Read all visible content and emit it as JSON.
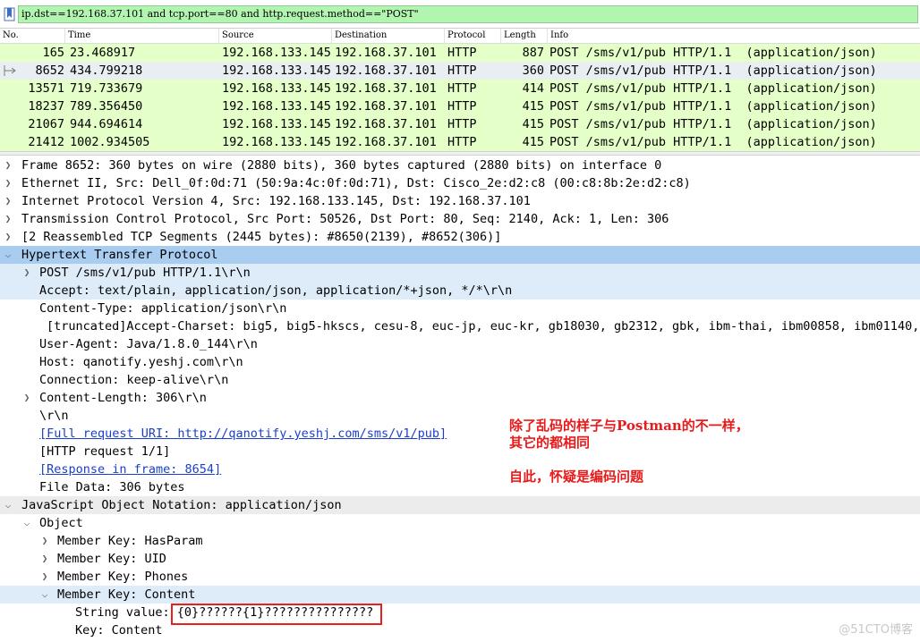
{
  "filter": {
    "value": "ip.dst==192.168.37.101 and tcp.port==80 and http.request.method==\"POST\""
  },
  "packet_list": {
    "columns": [
      "No.",
      "Time",
      "Source",
      "Destination",
      "Protocol",
      "Length",
      "Info"
    ],
    "rows": [
      {
        "no": "165",
        "time": "23.468917",
        "source": "192.168.133.145",
        "destination": "192.168.37.101",
        "protocol": "HTTP",
        "length": "887",
        "info": "POST /sms/v1/pub HTTP/1.1  (application/json)"
      },
      {
        "no": "8652",
        "time": "434.799218",
        "source": "192.168.133.145",
        "destination": "192.168.37.101",
        "protocol": "HTTP",
        "length": "360",
        "info": "POST /sms/v1/pub HTTP/1.1  (application/json)"
      },
      {
        "no": "13571",
        "time": "719.733679",
        "source": "192.168.133.145",
        "destination": "192.168.37.101",
        "protocol": "HTTP",
        "length": "414",
        "info": "POST /sms/v1/pub HTTP/1.1  (application/json)"
      },
      {
        "no": "18237",
        "time": "789.356450",
        "source": "192.168.133.145",
        "destination": "192.168.37.101",
        "protocol": "HTTP",
        "length": "415",
        "info": "POST /sms/v1/pub HTTP/1.1  (application/json)"
      },
      {
        "no": "21067",
        "time": "944.694614",
        "source": "192.168.133.145",
        "destination": "192.168.37.101",
        "protocol": "HTTP",
        "length": "415",
        "info": "POST /sms/v1/pub HTTP/1.1  (application/json)"
      },
      {
        "no": "21412",
        "time": "1002.934505",
        "source": "192.168.133.145",
        "destination": "192.168.37.101",
        "protocol": "HTTP",
        "length": "415",
        "info": "POST /sms/v1/pub HTTP/1.1  (application/json)"
      }
    ],
    "selected_no": "8652"
  },
  "details": [
    {
      "text": "Frame 8652: 360 bytes on wire (2880 bits), 360 bytes captured (2880 bits) on interface 0",
      "arrow": "collapsed"
    },
    {
      "text": "Ethernet II, Src: Dell_0f:0d:71 (50:9a:4c:0f:0d:71), Dst: Cisco_2e:d2:c8 (00:c8:8b:2e:d2:c8)",
      "arrow": "collapsed"
    },
    {
      "text": "Internet Protocol Version 4, Src: 192.168.133.145, Dst: 192.168.37.101",
      "arrow": "collapsed"
    },
    {
      "text": "Transmission Control Protocol, Src Port: 50526, Dst Port: 80, Seq: 2140, Ack: 1, Len: 306",
      "arrow": "collapsed"
    },
    {
      "text": "[2 Reassembled TCP Segments (2445 bytes): #8650(2139), #8652(306)]",
      "arrow": "collapsed"
    },
    {
      "text": "Hypertext Transfer Protocol",
      "arrow": "expanded"
    },
    {
      "text": "POST /sms/v1/pub HTTP/1.1\\r\\n",
      "arrow": "collapsed"
    },
    {
      "text": "Accept: text/plain, application/json, application/*+json, */*\\r\\n",
      "arrow": "none"
    },
    {
      "text": "Content-Type: application/json\\r\\n",
      "arrow": "none"
    },
    {
      "text": "[truncated]Accept-Charset: big5, big5-hkscs, cesu-8, euc-jp, euc-kr, gb18030, gb2312, gbk, ibm-thai, ibm00858, ibm01140, i",
      "arrow": "none"
    },
    {
      "text": "User-Agent: Java/1.8.0_144\\r\\n",
      "arrow": "none"
    },
    {
      "text": "Host: qanotify.yeshj.com\\r\\n",
      "arrow": "none"
    },
    {
      "text": "Connection: keep-alive\\r\\n",
      "arrow": "none"
    },
    {
      "text": "Content-Length: 306\\r\\n",
      "arrow": "collapsed"
    },
    {
      "text": "\\r\\n",
      "arrow": "none"
    },
    {
      "text": "[Full request URI: http://qanotify.yeshj.com/sms/v1/pub]",
      "arrow": "none"
    },
    {
      "text": "[HTTP request 1/1]",
      "arrow": "none"
    },
    {
      "text": "[Response in frame: 8654]",
      "arrow": "none"
    },
    {
      "text": "File Data: 306 bytes",
      "arrow": "none"
    },
    {
      "text": "JavaScript Object Notation: application/json",
      "arrow": "expanded"
    },
    {
      "text": "Object",
      "arrow": "expanded"
    },
    {
      "text": "Member Key: HasParam",
      "arrow": "collapsed"
    },
    {
      "text": "Member Key: UID",
      "arrow": "collapsed"
    },
    {
      "text": "Member Key: Phones",
      "arrow": "collapsed"
    },
    {
      "text": "Member Key: Content",
      "arrow": "expanded"
    },
    {
      "text": "String value: {0}??????{1}???????????????",
      "arrow": "none"
    },
    {
      "text": "Key: Content",
      "arrow": "none"
    }
  ],
  "annotation": {
    "line1": "除了乱码的样子与Postman的不一样，",
    "line2": "其它的都相同",
    "line3": "自此，怀疑是编码问题"
  },
  "watermark": "@51CTO博客",
  "colors": {
    "filter_bg": "#b1f5b0",
    "http_row_bg": "#e4ffc7",
    "selected_row_bg": "#e9eef3",
    "tree_highlight": "#a8cdf0",
    "tree_subhighlight": "#deebf8",
    "annotation_red": "#e81a1a",
    "link_blue": "#1a3fc9"
  }
}
